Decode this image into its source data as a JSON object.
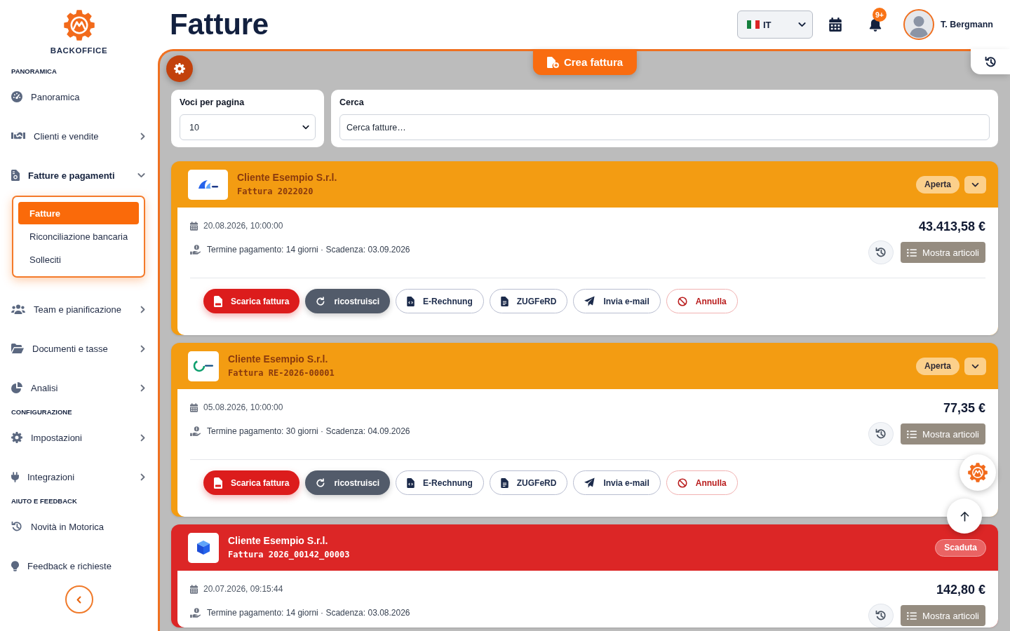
{
  "sidebar": {
    "brand": "BACKOFFICE",
    "sections": [
      {
        "title": "PANORAMICA",
        "items": [
          {
            "label": "Panoramica",
            "kind": "link"
          },
          {
            "label": "Clienti e vendite",
            "kind": "group",
            "expanded": false
          },
          {
            "label": "Fatture e pagamenti",
            "kind": "group",
            "expanded": true,
            "children": [
              {
                "label": "Fatture",
                "selected": true
              },
              {
                "label": "Riconciliazione bancaria",
                "selected": false
              },
              {
                "label": "Solleciti",
                "selected": false
              }
            ]
          },
          {
            "label": "Team e pianificazione",
            "kind": "group",
            "expanded": false
          },
          {
            "label": "Documenti e tasse",
            "kind": "group",
            "expanded": false
          },
          {
            "label": "Analisi",
            "kind": "group",
            "expanded": false
          }
        ]
      },
      {
        "title": "CONFIGURAZIONE",
        "items": [
          {
            "label": "Impostazioni",
            "kind": "group",
            "expanded": false
          },
          {
            "label": "Integrazioni",
            "kind": "group",
            "expanded": false
          }
        ]
      },
      {
        "title": "AIUTO E FEEDBACK",
        "items": [
          {
            "label": "Novità in Motorica",
            "kind": "link"
          },
          {
            "label": "Feedback e richieste",
            "kind": "link"
          }
        ]
      }
    ]
  },
  "header": {
    "title": "Fatture",
    "language": "IT",
    "notifications": "9+",
    "user": "T. Bergmann"
  },
  "toolbar": {
    "create_button": "Crea fattura"
  },
  "filters": {
    "page_size": {
      "label": "Voci per pagina",
      "value": "10"
    },
    "search": {
      "label": "Cerca",
      "placeholder": "Cerca fatture…"
    }
  },
  "invoices": [
    {
      "client": "Cliente Esempio S.r.l.",
      "number": "Fattura 2022020",
      "status": {
        "label": "Aperta",
        "kind": "open"
      },
      "expand_toggle": true,
      "date": "20.08.2026, 10:00:00",
      "amount": "43.413,58 €",
      "terms": "Termine pagamento: 14 giorni · Scadenza: 03.09.2026",
      "items_button": "Mostra articoli",
      "actions": [
        {
          "label": "Scarica fattura",
          "kind": "primary"
        },
        {
          "label": "ricostruisci",
          "kind": "secondary"
        },
        {
          "label": "E-Rechnung",
          "kind": "outline"
        },
        {
          "label": "ZUGFeRD",
          "kind": "outline"
        },
        {
          "label": "Invia e-mail",
          "kind": "outline"
        },
        {
          "label": "Annulla",
          "kind": "danger"
        }
      ]
    },
    {
      "client": "Cliente Esempio S.r.l.",
      "number": "Fattura RE-2026-00001",
      "status": {
        "label": "Aperta",
        "kind": "open"
      },
      "expand_toggle": true,
      "date": "05.08.2026, 10:00:00",
      "amount": "77,35 €",
      "terms": "Termine pagamento: 30 giorni · Scadenza: 04.09.2026",
      "items_button": "Mostra articoli",
      "actions": [
        {
          "label": "Scarica fattura",
          "kind": "primary"
        },
        {
          "label": "ricostruisci",
          "kind": "secondary"
        },
        {
          "label": "E-Rechnung",
          "kind": "outline"
        },
        {
          "label": "ZUGFeRD",
          "kind": "outline"
        },
        {
          "label": "Invia e-mail",
          "kind": "outline"
        },
        {
          "label": "Annulla",
          "kind": "danger"
        }
      ]
    },
    {
      "client": "Cliente Esempio S.r.l.",
      "number": "Fattura 2026_00142_00003",
      "status": {
        "label": "Scaduta",
        "kind": "overdue"
      },
      "expand_toggle": false,
      "date": "20.07.2026, 09:15:44",
      "amount": "142,80 €",
      "terms": "Termine pagamento: 14 giorni · Scadenza: 03.08.2026",
      "items_button": "Mostra articoli"
    }
  ]
}
